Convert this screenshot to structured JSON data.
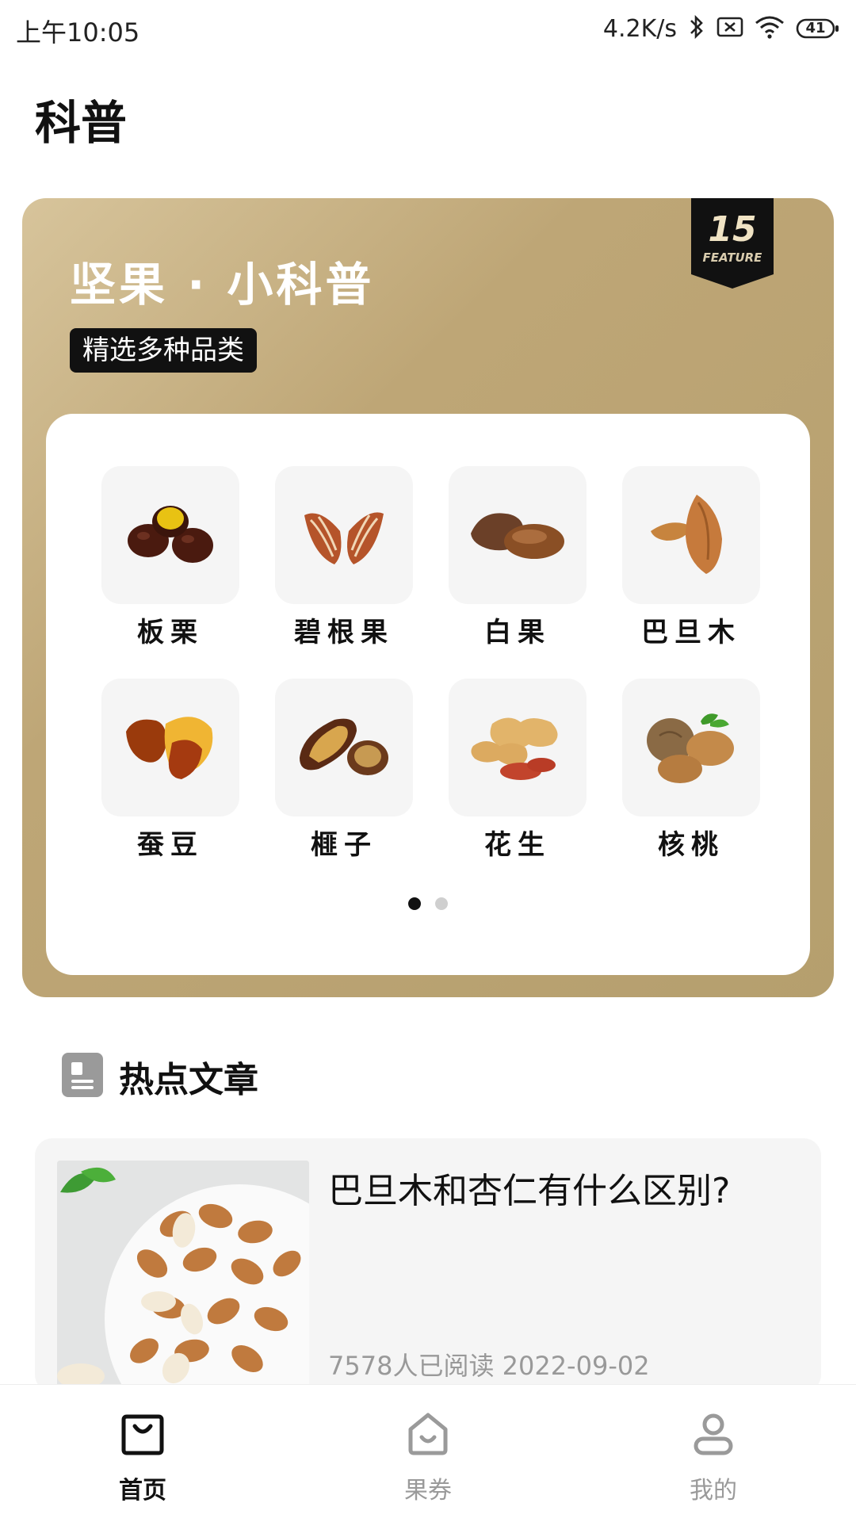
{
  "status_bar": {
    "time": "上午10:05",
    "net_speed": "4.2K/s",
    "battery": "41",
    "icons": [
      "bluetooth-icon",
      "sim-blocked-icon",
      "wifi-icon",
      "battery-icon"
    ]
  },
  "page": {
    "title": "科普"
  },
  "banner": {
    "title": "坚果 · 小科普",
    "tag": "精选多种品类",
    "badge_number": "15",
    "badge_text": "FEATURE",
    "colors": {
      "gradient_start": "#d7c49b",
      "gradient_end": "#b59f6e"
    },
    "items": [
      {
        "label": "板栗",
        "icon": "chestnut-icon"
      },
      {
        "label": "碧根果",
        "icon": "pecan-icon"
      },
      {
        "label": "白果",
        "icon": "ginkgo-icon"
      },
      {
        "label": "巴旦木",
        "icon": "almond-icon"
      },
      {
        "label": "蚕豆",
        "icon": "broad-bean-icon"
      },
      {
        "label": "榧子",
        "icon": "torreya-icon"
      },
      {
        "label": "花生",
        "icon": "peanut-icon"
      },
      {
        "label": "核桃",
        "icon": "walnut-icon"
      }
    ],
    "pager": {
      "pages": 2,
      "current": 1
    }
  },
  "hot_articles": {
    "title": "热点文章",
    "items": [
      {
        "title": "巴旦木和杏仁有什么区别?",
        "meta": "7578人已阅读    2022-09-02"
      }
    ]
  },
  "bottom_nav": {
    "items": [
      {
        "label": "首页",
        "active": true
      },
      {
        "label": "果券",
        "active": false
      },
      {
        "label": "我的",
        "active": false
      }
    ]
  }
}
